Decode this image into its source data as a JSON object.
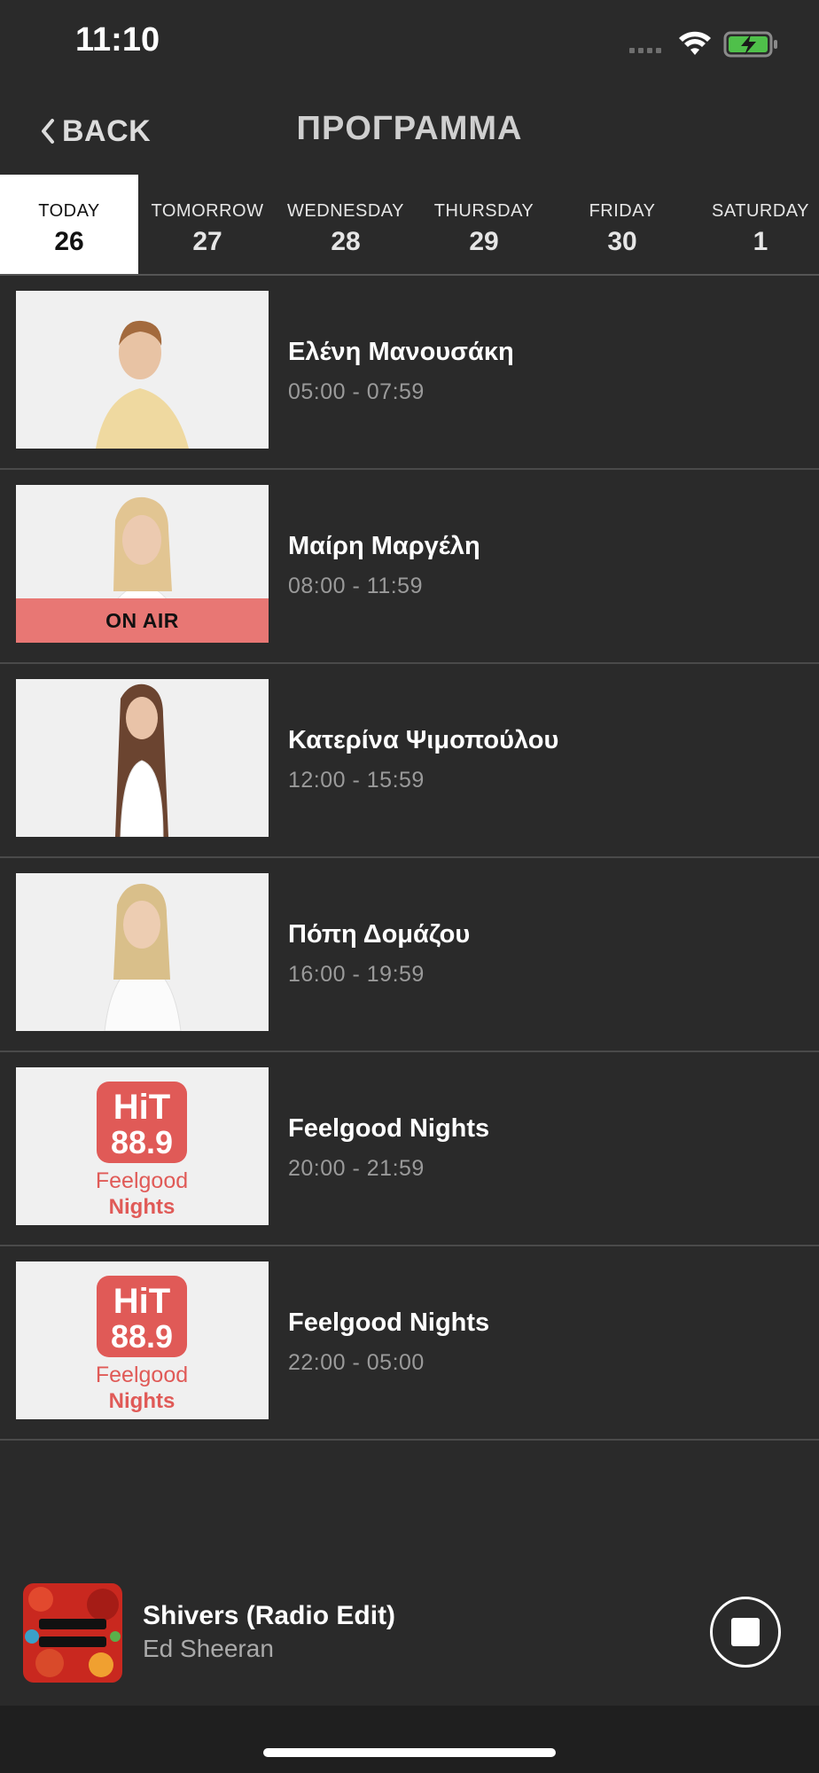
{
  "status": {
    "time": "11:10"
  },
  "nav": {
    "back_label": "BACK",
    "title": "ΠΡΟΓΡΑΜΜΑ"
  },
  "days": [
    {
      "name": "TODAY",
      "num": "26",
      "active": true
    },
    {
      "name": "TOMORROW",
      "num": "27",
      "active": false
    },
    {
      "name": "WEDNESDAY",
      "num": "28",
      "active": false
    },
    {
      "name": "THURSDAY",
      "num": "29",
      "active": false
    },
    {
      "name": "FRIDAY",
      "num": "30",
      "active": false
    },
    {
      "name": "SATURDAY",
      "num": "1",
      "active": false
    }
  ],
  "shows": [
    {
      "name": "Ελένη Μανουσάκη",
      "time": "05:00 - 07:59",
      "image": "host-photo",
      "on_air": ""
    },
    {
      "name": "Μαίρη Μαργέλη",
      "time": "08:00 - 11:59",
      "image": "host-photo",
      "on_air": "ON AIR"
    },
    {
      "name": "Κατερίνα Ψιμοπούλου",
      "time": "12:00 - 15:59",
      "image": "host-photo",
      "on_air": ""
    },
    {
      "name": "Πόπη Δομάζου",
      "time": "16:00 - 19:59",
      "image": "host-photo",
      "on_air": ""
    },
    {
      "name": "Feelgood Nights",
      "time": "20:00 - 21:59",
      "image": "hit-logo",
      "on_air": ""
    },
    {
      "name": "Feelgood Nights",
      "time": "22:00 - 05:00",
      "image": "hit-logo",
      "on_air": ""
    }
  ],
  "logo": {
    "line1": "HiT",
    "line2": "88.9",
    "line3": "Feelgood",
    "line4": "Nights"
  },
  "player": {
    "title": "Shivers (Radio Edit)",
    "artist": "Ed Sheeran"
  },
  "colors": {
    "accent": "#e05a57",
    "on_air_bg": "#e87774",
    "background": "#2a2a2a"
  }
}
